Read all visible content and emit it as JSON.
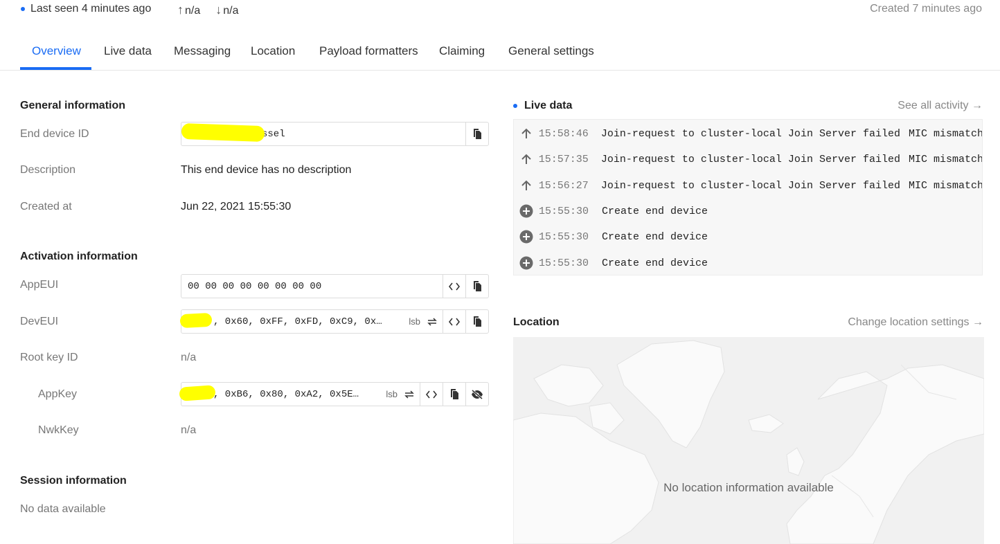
{
  "status": {
    "last_seen": "Last seen 4 minutes ago",
    "uplink": "n/a",
    "downlink": "n/a",
    "created": "Created 7 minutes ago"
  },
  "tabs": [
    {
      "label": "Overview",
      "active": true
    },
    {
      "label": "Live data"
    },
    {
      "label": "Messaging"
    },
    {
      "label": "Location"
    },
    {
      "label": "Payload formatters"
    },
    {
      "label": "Claiming"
    },
    {
      "label": "General settings"
    }
  ],
  "general": {
    "title": "General information",
    "end_device_id_label": "End device ID",
    "end_device_id_value": "ssel",
    "description_label": "Description",
    "description_value": "This end device has no description",
    "created_at_label": "Created at",
    "created_at_value": "Jun 22, 2021 15:55:30"
  },
  "activation": {
    "title": "Activation information",
    "appeui_label": "AppEUI",
    "appeui_value": "00 00 00 00 00 00 00 00",
    "deveui_label": "DevEUI",
    "deveui_value": ", 0x60, 0xFF, 0xFD, 0xC9, 0x…",
    "root_key_label": "Root key ID",
    "root_key_value": "n/a",
    "appkey_label": "AppKey",
    "appkey_value": ", 0xB6, 0x80, 0xA2, 0x5E…",
    "nwkkey_label": "NwkKey",
    "nwkkey_value": "n/a",
    "lsb_label": "lsb"
  },
  "session": {
    "title": "Session information",
    "value": "No data available"
  },
  "live_data": {
    "title": "Live data",
    "see_all": "See all activity →",
    "events": [
      {
        "icon": "arrow-up-icon",
        "time": "15:58:46",
        "message": "Join-request to cluster-local Join Server failed",
        "error": "MIC mismatch"
      },
      {
        "icon": "arrow-up-icon",
        "time": "15:57:35",
        "message": "Join-request to cluster-local Join Server failed",
        "error": "MIC mismatch"
      },
      {
        "icon": "arrow-up-icon",
        "time": "15:56:27",
        "message": "Join-request to cluster-local Join Server failed",
        "error": "MIC mismatch"
      },
      {
        "icon": "plus-circle-icon",
        "time": "15:55:30",
        "message": "Create end device",
        "error": ""
      },
      {
        "icon": "plus-circle-icon",
        "time": "15:55:30",
        "message": "Create end device",
        "error": ""
      },
      {
        "icon": "plus-circle-icon",
        "time": "15:55:30",
        "message": "Create end device",
        "error": ""
      }
    ]
  },
  "location": {
    "title": "Location",
    "change": "Change location settings →",
    "empty": "No location information available"
  },
  "colors": {
    "accent": "#1a6cf4",
    "highlight": "#ffff00"
  }
}
